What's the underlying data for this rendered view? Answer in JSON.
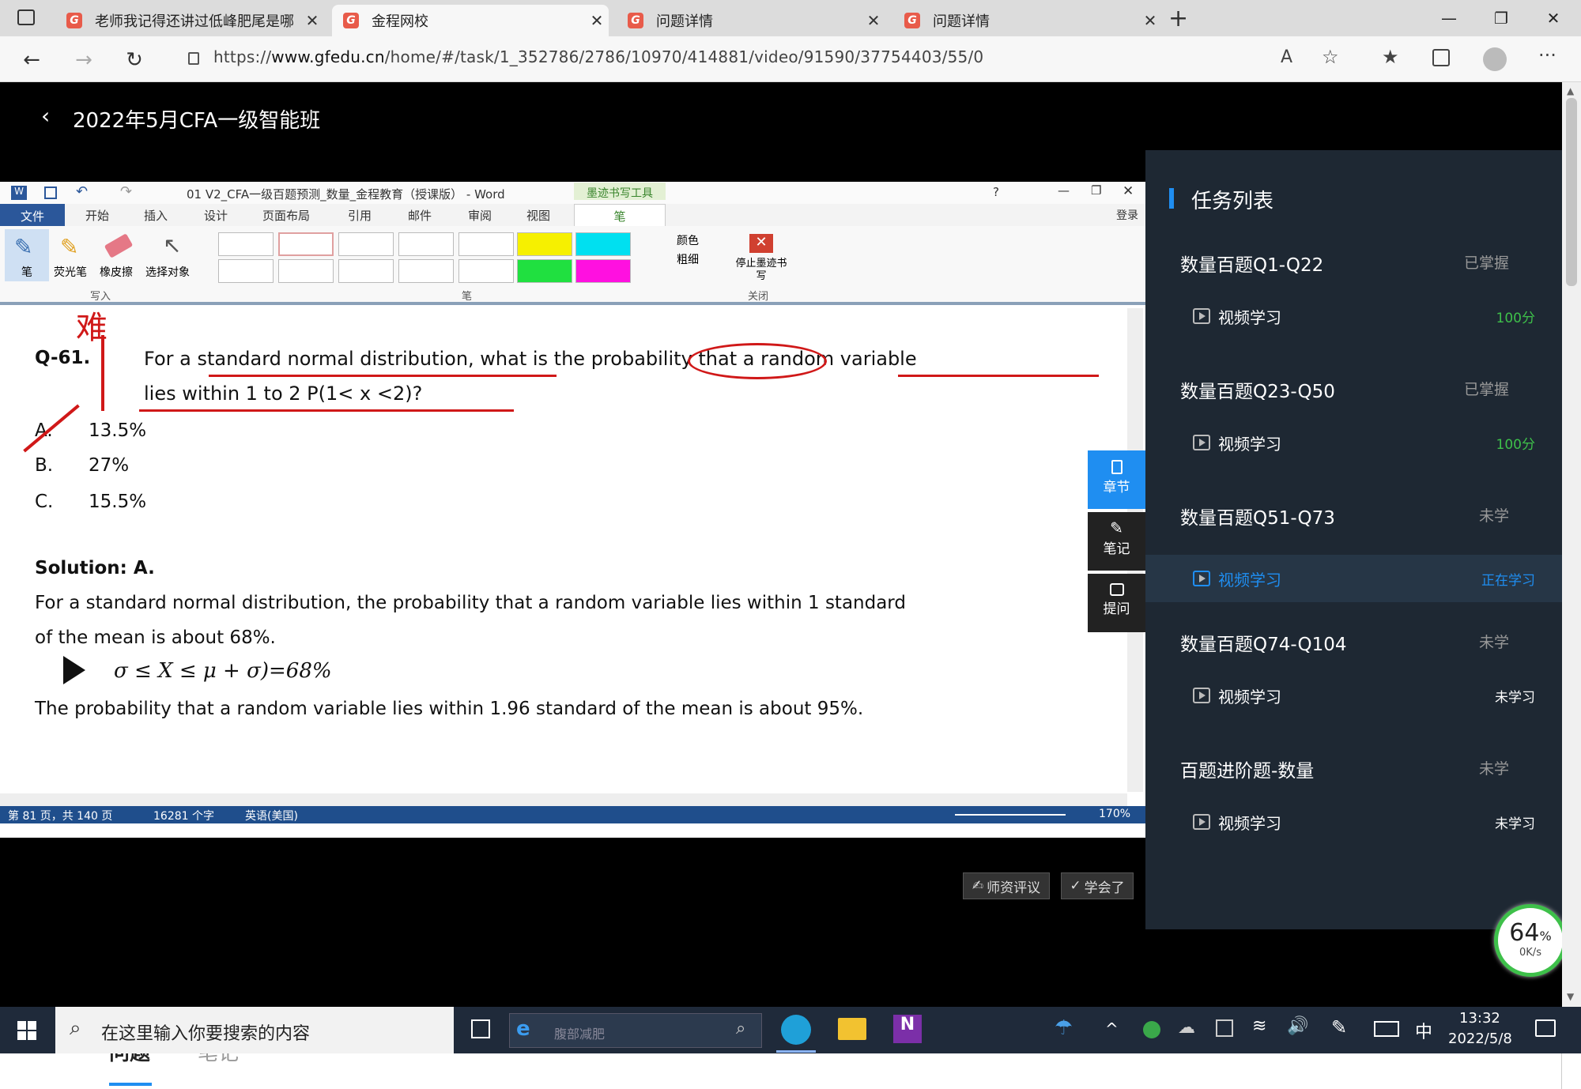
{
  "browser": {
    "tabs": [
      {
        "title": "老师我记得还讲过低峰肥尾是哪",
        "active": false
      },
      {
        "title": "金程网校",
        "active": true
      },
      {
        "title": "问题详情",
        "active": false
      },
      {
        "title": "问题详情",
        "active": false
      }
    ],
    "url_prefix": "https://",
    "url_domain": "www.gfedu.cn",
    "url_path": "/home/#/task/1_352786/2786/10970/414881/video/91590/37754403/55/0"
  },
  "course": {
    "title": "2022年5月CFA一级智能班"
  },
  "word": {
    "title": "01 V2_CFA一级百题预测_数量_金程教育（授课版） - Word",
    "ink_tools": "墨迹书写工具",
    "pen_tab": "笔",
    "login": "登录",
    "menu": [
      "文件",
      "开始",
      "插入",
      "设计",
      "页面布局",
      "引用",
      "邮件",
      "审阅",
      "视图"
    ],
    "tools": [
      "笔",
      "荧光笔",
      "橡皮擦",
      "选择对象"
    ],
    "group_write": "写入",
    "group_pen": "笔",
    "group_close": "关闭",
    "color_label": "颜色",
    "weight_label": "粗细",
    "stop_label": "停止墨迹书写",
    "status_page": "第 81 页，共 140 页",
    "status_words": "16281 个字",
    "status_lang": "英语(美国)",
    "zoom": "170%"
  },
  "doc": {
    "annotation": "难",
    "q_label": "Q-61.",
    "q_line1": "For a standard normal distribution, what is the probability that a random variable",
    "q_line2": "lies within 1 to 2 P(1< x <2)?",
    "options": [
      {
        "k": "A.",
        "v": "13.5%"
      },
      {
        "k": "B.",
        "v": "27%"
      },
      {
        "k": "C.",
        "v": "15.5%"
      }
    ],
    "solution": "Solution: A.",
    "sol_line1": "For a standard normal distribution, the probability that a random variable lies within 1 standard",
    "sol_line2": "of the mean is about 68%.",
    "formula": "σ ≤ X ≤ μ + σ)=68%",
    "sol_line3": "The probability that a random variable lies within 1.96 standard of the mean is about 95%."
  },
  "side_tools": [
    {
      "label": "章节",
      "icon": "chapter-icon"
    },
    {
      "label": "笔记",
      "icon": "note-pen-icon"
    },
    {
      "label": "提问",
      "icon": "question-bubble-icon"
    }
  ],
  "actions": {
    "review": "师资评议",
    "learned": "学会了"
  },
  "panel": {
    "title": "任务列表",
    "groups": [
      {
        "name": "数量百题Q1-Q22",
        "status": "已掌握",
        "video": "视频学习",
        "vstatus": "100分",
        "vcolor": "#3ec04a"
      },
      {
        "name": "数量百题Q23-Q50",
        "status": "已掌握",
        "video": "视频学习",
        "vstatus": "100分",
        "vcolor": "#3ec04a"
      },
      {
        "name": "数量百题Q51-Q73",
        "status": "未学",
        "video": "视频学习",
        "vstatus": "正在学习",
        "vcolor": "#1f8ef1"
      },
      {
        "name": "数量百题Q74-Q104",
        "status": "未学",
        "video": "视频学习",
        "vstatus": "未学习",
        "vcolor": "#ffffff"
      },
      {
        "name": "百题进阶题-数量",
        "status": "未学",
        "video": "视频学习",
        "vstatus": "未学习",
        "vcolor": "#ffffff"
      }
    ]
  },
  "bottom_tabs": {
    "questions": "问题",
    "notes": "笔记"
  },
  "net": {
    "percent": "64",
    "unit": "%",
    "speed": "0K/s"
  },
  "taskbar": {
    "search": "在这里输入你要搜索的内容",
    "ie_placeholder": "腹部减肥",
    "ime": "中",
    "time": "13:32",
    "date": "2022/5/8"
  }
}
